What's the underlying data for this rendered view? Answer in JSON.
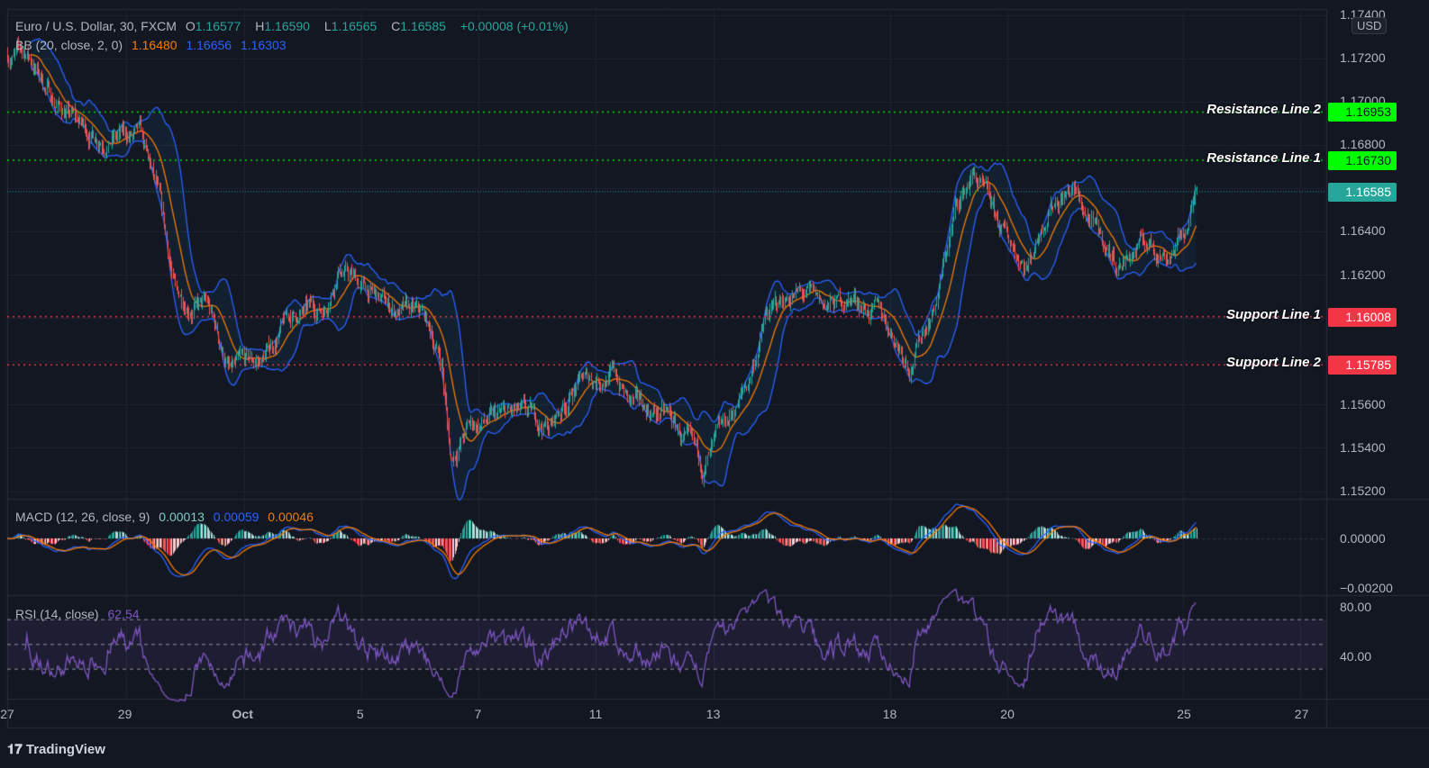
{
  "header": {
    "symbol": "Euro / U.S. Dollar, 30, FXCM",
    "o_label": "O",
    "o": "1.16577",
    "h_label": "H",
    "h": "1.16590",
    "l_label": "L",
    "l": "1.16565",
    "c_label": "C",
    "c": "1.16585",
    "change": "+0.00008 (+0.01%)"
  },
  "bb": {
    "label": "BB (20, close, 2, 0)",
    "basis": "1.16480",
    "upper": "1.16656",
    "lower": "1.16303"
  },
  "macd": {
    "label": "MACD (12, 26, close, 9)",
    "hist": "0.00013",
    "macd": "0.00059",
    "signal": "0.00046",
    "axis": [
      "0.00000",
      "−0.00200"
    ]
  },
  "rsi": {
    "label": "RSI (14, close)",
    "value": "62.54",
    "axis": [
      "80.00",
      "40.00"
    ]
  },
  "currency": "USD",
  "branding": "TradingView",
  "price_axis": [
    "1.17400",
    "1.17200",
    "1.17000",
    "1.16800",
    "1.16400",
    "1.16200",
    "1.15600",
    "1.15400",
    "1.15200"
  ],
  "levels": [
    {
      "label": "Resistance Line 2",
      "value": "1.16953",
      "color": "#00ff00"
    },
    {
      "label": "Resistance Line 1",
      "value": "1.16730",
      "color": "#00ff00"
    },
    {
      "label": "Support Line 1",
      "value": "1.16008",
      "color": "#f23645"
    },
    {
      "label": "Support Line 2",
      "value": "1.15785",
      "color": "#f23645"
    }
  ],
  "last_price": {
    "value": "1.16585",
    "color": "#26a69a"
  },
  "chart_data": {
    "type": "candlestick",
    "title": "Euro / U.S. Dollar, 30, FXCM",
    "ylim": [
      1.152,
      1.174
    ],
    "x_ticks": [
      {
        "day": 0,
        "label": "27"
      },
      {
        "day": 2,
        "label": "29"
      },
      {
        "day": 4,
        "label": "Oct"
      },
      {
        "day": 6,
        "label": "5"
      },
      {
        "day": 8,
        "label": "7"
      },
      {
        "day": 10,
        "label": "11"
      },
      {
        "day": 12,
        "label": "13"
      },
      {
        "day": 15,
        "label": "18"
      },
      {
        "day": 17,
        "label": "20"
      },
      {
        "day": 20,
        "label": "25"
      },
      {
        "day": 22,
        "label": "27"
      }
    ],
    "close_path": [
      [
        0,
        1.1722
      ],
      [
        0.34,
        1.1722
      ],
      [
        0.8,
        1.17
      ],
      [
        1.41,
        1.1685
      ],
      [
        2.25,
        1.1683
      ],
      [
        2.56,
        1.1655
      ],
      [
        2.86,
        1.161
      ],
      [
        3.4,
        1.1605
      ],
      [
        3.78,
        1.1575
      ],
      [
        4.32,
        1.158
      ],
      [
        4.78,
        1.16
      ],
      [
        5.39,
        1.1605
      ],
      [
        5.62,
        1.1625
      ],
      [
        6.0,
        1.1615
      ],
      [
        6.46,
        1.1605
      ],
      [
        7.07,
        1.16
      ],
      [
        7.38,
        1.158
      ],
      [
        7.53,
        1.1535
      ],
      [
        7.84,
        1.155
      ],
      [
        8.61,
        1.1555
      ],
      [
        9.22,
        1.155
      ],
      [
        9.68,
        1.157
      ],
      [
        10.29,
        1.1575
      ],
      [
        10.6,
        1.156
      ],
      [
        11.21,
        1.1555
      ],
      [
        11.82,
        1.153
      ],
      [
        12.13,
        1.1545
      ],
      [
        12.59,
        1.157
      ],
      [
        12.89,
        1.16
      ],
      [
        13.35,
        1.1612
      ],
      [
        13.97,
        1.1605
      ],
      [
        14.35,
        1.161
      ],
      [
        14.89,
        1.16
      ],
      [
        15.34,
        1.158
      ],
      [
        15.8,
        1.161
      ],
      [
        16.11,
        1.165
      ],
      [
        16.42,
        1.1667
      ],
      [
        16.88,
        1.164
      ],
      [
        17.34,
        1.1625
      ],
      [
        17.72,
        1.1655
      ],
      [
        18.1,
        1.166
      ],
      [
        18.48,
        1.164
      ],
      [
        18.87,
        1.1625
      ],
      [
        19.33,
        1.1635
      ],
      [
        19.71,
        1.163
      ],
      [
        20.02,
        1.164
      ],
      [
        20.21,
        1.16585
      ]
    ],
    "bars_per_day": 48
  }
}
